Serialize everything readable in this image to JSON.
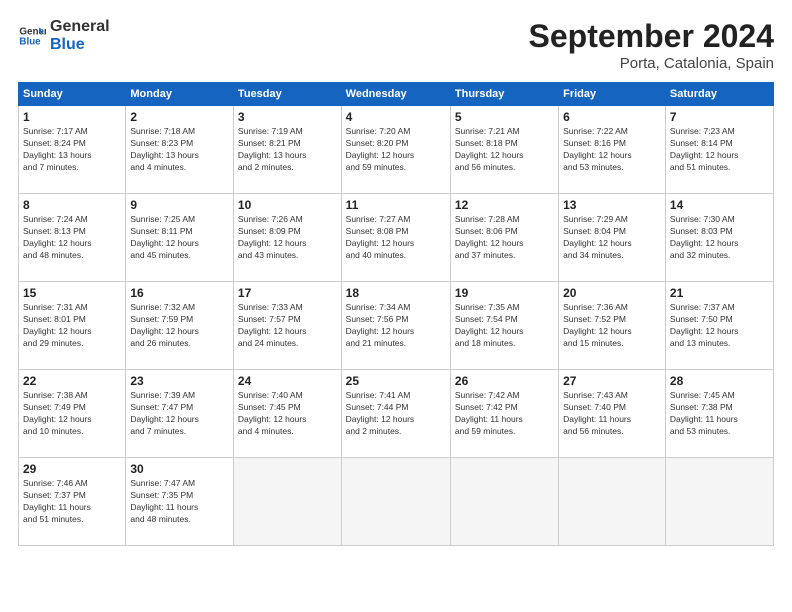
{
  "logo": {
    "line1": "General",
    "line2": "Blue"
  },
  "title": "September 2024",
  "subtitle": "Porta, Catalonia, Spain",
  "days_header": [
    "Sunday",
    "Monday",
    "Tuesday",
    "Wednesday",
    "Thursday",
    "Friday",
    "Saturday"
  ],
  "weeks": [
    [
      {
        "day": "1",
        "info": "Sunrise: 7:17 AM\nSunset: 8:24 PM\nDaylight: 13 hours\nand 7 minutes."
      },
      {
        "day": "2",
        "info": "Sunrise: 7:18 AM\nSunset: 8:23 PM\nDaylight: 13 hours\nand 4 minutes."
      },
      {
        "day": "3",
        "info": "Sunrise: 7:19 AM\nSunset: 8:21 PM\nDaylight: 13 hours\nand 2 minutes."
      },
      {
        "day": "4",
        "info": "Sunrise: 7:20 AM\nSunset: 8:20 PM\nDaylight: 12 hours\nand 59 minutes."
      },
      {
        "day": "5",
        "info": "Sunrise: 7:21 AM\nSunset: 8:18 PM\nDaylight: 12 hours\nand 56 minutes."
      },
      {
        "day": "6",
        "info": "Sunrise: 7:22 AM\nSunset: 8:16 PM\nDaylight: 12 hours\nand 53 minutes."
      },
      {
        "day": "7",
        "info": "Sunrise: 7:23 AM\nSunset: 8:14 PM\nDaylight: 12 hours\nand 51 minutes."
      }
    ],
    [
      {
        "day": "8",
        "info": "Sunrise: 7:24 AM\nSunset: 8:13 PM\nDaylight: 12 hours\nand 48 minutes."
      },
      {
        "day": "9",
        "info": "Sunrise: 7:25 AM\nSunset: 8:11 PM\nDaylight: 12 hours\nand 45 minutes."
      },
      {
        "day": "10",
        "info": "Sunrise: 7:26 AM\nSunset: 8:09 PM\nDaylight: 12 hours\nand 43 minutes."
      },
      {
        "day": "11",
        "info": "Sunrise: 7:27 AM\nSunset: 8:08 PM\nDaylight: 12 hours\nand 40 minutes."
      },
      {
        "day": "12",
        "info": "Sunrise: 7:28 AM\nSunset: 8:06 PM\nDaylight: 12 hours\nand 37 minutes."
      },
      {
        "day": "13",
        "info": "Sunrise: 7:29 AM\nSunset: 8:04 PM\nDaylight: 12 hours\nand 34 minutes."
      },
      {
        "day": "14",
        "info": "Sunrise: 7:30 AM\nSunset: 8:03 PM\nDaylight: 12 hours\nand 32 minutes."
      }
    ],
    [
      {
        "day": "15",
        "info": "Sunrise: 7:31 AM\nSunset: 8:01 PM\nDaylight: 12 hours\nand 29 minutes."
      },
      {
        "day": "16",
        "info": "Sunrise: 7:32 AM\nSunset: 7:59 PM\nDaylight: 12 hours\nand 26 minutes."
      },
      {
        "day": "17",
        "info": "Sunrise: 7:33 AM\nSunset: 7:57 PM\nDaylight: 12 hours\nand 24 minutes."
      },
      {
        "day": "18",
        "info": "Sunrise: 7:34 AM\nSunset: 7:56 PM\nDaylight: 12 hours\nand 21 minutes."
      },
      {
        "day": "19",
        "info": "Sunrise: 7:35 AM\nSunset: 7:54 PM\nDaylight: 12 hours\nand 18 minutes."
      },
      {
        "day": "20",
        "info": "Sunrise: 7:36 AM\nSunset: 7:52 PM\nDaylight: 12 hours\nand 15 minutes."
      },
      {
        "day": "21",
        "info": "Sunrise: 7:37 AM\nSunset: 7:50 PM\nDaylight: 12 hours\nand 13 minutes."
      }
    ],
    [
      {
        "day": "22",
        "info": "Sunrise: 7:38 AM\nSunset: 7:49 PM\nDaylight: 12 hours\nand 10 minutes."
      },
      {
        "day": "23",
        "info": "Sunrise: 7:39 AM\nSunset: 7:47 PM\nDaylight: 12 hours\nand 7 minutes."
      },
      {
        "day": "24",
        "info": "Sunrise: 7:40 AM\nSunset: 7:45 PM\nDaylight: 12 hours\nand 4 minutes."
      },
      {
        "day": "25",
        "info": "Sunrise: 7:41 AM\nSunset: 7:44 PM\nDaylight: 12 hours\nand 2 minutes."
      },
      {
        "day": "26",
        "info": "Sunrise: 7:42 AM\nSunset: 7:42 PM\nDaylight: 11 hours\nand 59 minutes."
      },
      {
        "day": "27",
        "info": "Sunrise: 7:43 AM\nSunset: 7:40 PM\nDaylight: 11 hours\nand 56 minutes."
      },
      {
        "day": "28",
        "info": "Sunrise: 7:45 AM\nSunset: 7:38 PM\nDaylight: 11 hours\nand 53 minutes."
      }
    ],
    [
      {
        "day": "29",
        "info": "Sunrise: 7:46 AM\nSunset: 7:37 PM\nDaylight: 11 hours\nand 51 minutes."
      },
      {
        "day": "30",
        "info": "Sunrise: 7:47 AM\nSunset: 7:35 PM\nDaylight: 11 hours\nand 48 minutes."
      },
      {
        "day": "",
        "info": ""
      },
      {
        "day": "",
        "info": ""
      },
      {
        "day": "",
        "info": ""
      },
      {
        "day": "",
        "info": ""
      },
      {
        "day": "",
        "info": ""
      }
    ]
  ]
}
